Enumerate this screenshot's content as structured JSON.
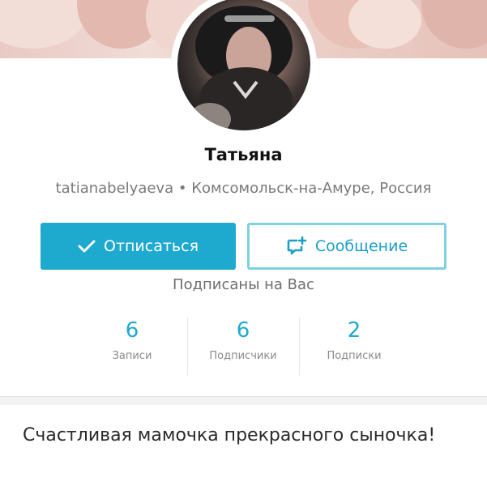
{
  "profile": {
    "name": "Татьяна",
    "username": "tatianabelyaeva",
    "separator": "•",
    "location": "Комсомольск-на-Амуре, Россия",
    "follows_you": "Подписаны на Вас",
    "bio": "Счастливая мамочка прекрасного сыночка!"
  },
  "actions": {
    "unfollow_label": "Отписаться",
    "unfollow_icon": "check-icon",
    "message_label": "Сообщение",
    "message_icon": "new-message-icon"
  },
  "stats": [
    {
      "value": "6",
      "label": "Записи"
    },
    {
      "value": "6",
      "label": "Подписчики"
    },
    {
      "value": "2",
      "label": "Подписки"
    }
  ],
  "colors": {
    "accent": "#1ea9cf",
    "accent_border": "#7fd0e3",
    "text_primary": "#111111",
    "text_secondary": "#7a7a7a"
  }
}
